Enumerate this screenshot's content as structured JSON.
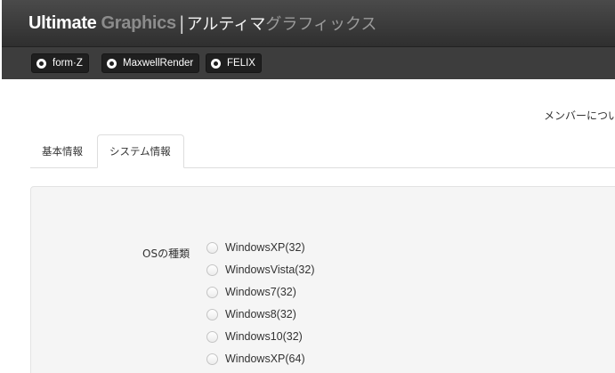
{
  "header": {
    "brand_ultimate": "Ultimate",
    "brand_graphics": "Graphics",
    "brand_separator": "|",
    "brand_jp_primary": "アルティマ",
    "brand_jp_secondary": "グラフィックス",
    "nav": [
      {
        "label": "form·Z",
        "icon": "soccer-ball-icon"
      },
      {
        "label": "MaxwellRender",
        "icon": "soccer-ball-icon"
      },
      {
        "label": "FELIX",
        "icon": "soccer-ball-icon"
      }
    ]
  },
  "member_link": "メンバーについ",
  "tabs": [
    {
      "label": "基本情報",
      "active": false
    },
    {
      "label": "システム情報",
      "active": true
    }
  ],
  "form": {
    "os_label": "OSの種類",
    "os_options": [
      "WindowsXP(32)",
      "WindowsVista(32)",
      "Windows7(32)",
      "Windows8(32)",
      "Windows10(32)",
      "WindowsXP(64)"
    ]
  },
  "colors": {
    "header_bg": "#3b3b3b",
    "nav_button_bg": "#1f1f1f",
    "panel_bg": "#f5f5f5"
  }
}
